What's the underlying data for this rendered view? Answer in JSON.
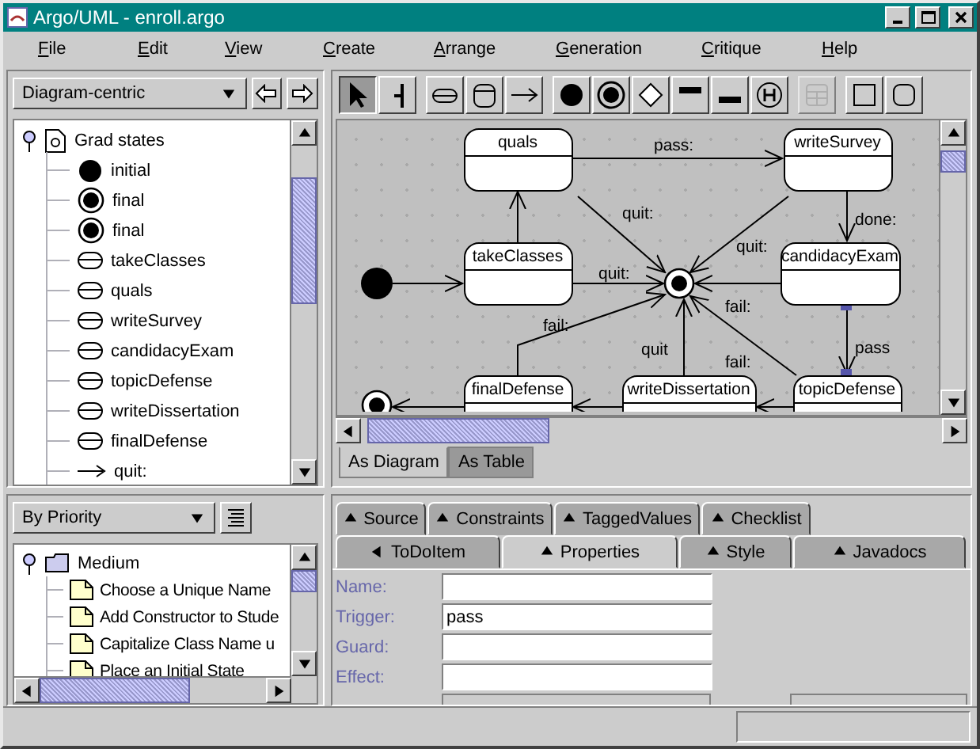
{
  "window": {
    "title": "Argo/UML - enroll.argo"
  },
  "menu": [
    "File",
    "Edit",
    "View",
    "Create",
    "Arrange",
    "Generation",
    "Critique",
    "Help"
  ],
  "navigator": {
    "perspective": "Diagram-centric",
    "tree": {
      "label": "Grad states",
      "expanded": true,
      "children": [
        {
          "label": "initial",
          "kind": "initial"
        },
        {
          "label": "final",
          "kind": "final"
        },
        {
          "label": "final",
          "kind": "final"
        },
        {
          "label": "takeClasses",
          "kind": "state"
        },
        {
          "label": "quals",
          "kind": "state"
        },
        {
          "label": "writeSurvey",
          "kind": "state"
        },
        {
          "label": "candidacyExam",
          "kind": "state"
        },
        {
          "label": "topicDefense",
          "kind": "state"
        },
        {
          "label": "writeDissertation",
          "kind": "state"
        },
        {
          "label": "finalDefense",
          "kind": "state"
        },
        {
          "label": "quit:",
          "kind": "transition"
        }
      ]
    }
  },
  "toolbar": [
    {
      "kind": "select",
      "selected": true,
      "disabled": false
    },
    {
      "kind": "broom",
      "selected": false,
      "disabled": false
    },
    {
      "kind": "state",
      "selected": false,
      "disabled": false
    },
    {
      "kind": "composite",
      "selected": false,
      "disabled": false
    },
    {
      "kind": "transition",
      "selected": false,
      "disabled": false
    },
    {
      "kind": "initial",
      "selected": false,
      "disabled": false
    },
    {
      "kind": "final",
      "selected": false,
      "disabled": false
    },
    {
      "kind": "branch",
      "selected": false,
      "disabled": false
    },
    {
      "kind": "fork",
      "selected": false,
      "disabled": false
    },
    {
      "kind": "join",
      "selected": false,
      "disabled": false
    },
    {
      "kind": "history",
      "selected": false,
      "disabled": false
    },
    {
      "kind": "concurrent",
      "selected": false,
      "disabled": true
    },
    {
      "kind": "rectangle",
      "selected": false,
      "disabled": false
    },
    {
      "kind": "rounded",
      "selected": false,
      "disabled": false
    }
  ],
  "diagram": {
    "states": [
      {
        "name": "quals"
      },
      {
        "name": "writeSurvey"
      },
      {
        "name": "takeClasses"
      },
      {
        "name": "candidacyExam"
      },
      {
        "name": "finalDefense"
      },
      {
        "name": "writeDissertation"
      },
      {
        "name": "topicDefense"
      }
    ],
    "pseudostates": [
      {
        "kind": "initial"
      },
      {
        "kind": "final"
      },
      {
        "kind": "final"
      }
    ],
    "transitions": [
      {
        "label": "pass:",
        "selected": false
      },
      {
        "label": "quit:",
        "selected": false
      },
      {
        "label": "done:",
        "selected": false
      },
      {
        "label": "quit:",
        "selected": false
      },
      {
        "label": "quit:",
        "selected": false
      },
      {
        "label": "fail:",
        "selected": false
      },
      {
        "label": "fail:",
        "selected": false
      },
      {
        "label": "quit",
        "selected": false
      },
      {
        "label": "fail:",
        "selected": false
      },
      {
        "label": "pass",
        "selected": true
      }
    ]
  },
  "view_tabs": [
    {
      "label": "As Diagram",
      "selected": true
    },
    {
      "label": "As Table",
      "selected": false
    }
  ],
  "todo": {
    "grouping": "By Priority",
    "tree": {
      "label": "Medium",
      "expanded": true,
      "children": [
        {
          "label": "Choose a Unique Name"
        },
        {
          "label": "Add Constructor to Stude"
        },
        {
          "label": "Capitalize Class Name u"
        },
        {
          "label": "Place an Initial State"
        }
      ]
    }
  },
  "detail_tabs": [
    [
      {
        "label": "Source",
        "selected": false,
        "kind": "up"
      },
      {
        "label": "Constraints",
        "selected": false,
        "kind": "up"
      },
      {
        "label": "TaggedValues",
        "selected": false,
        "kind": "up"
      },
      {
        "label": "Checklist",
        "selected": false,
        "kind": "up"
      }
    ],
    [
      {
        "label": "ToDoItem",
        "selected": false,
        "kind": "left"
      },
      {
        "label": "Properties",
        "selected": true,
        "kind": "up"
      },
      {
        "label": "Style",
        "selected": false,
        "kind": "up"
      },
      {
        "label": "Javadocs",
        "selected": false,
        "kind": "up"
      }
    ]
  ],
  "properties": [
    {
      "label": "Name:"
    },
    {
      "label": "Trigger:",
      "value": "pass"
    },
    {
      "label": "Guard:"
    },
    {
      "label": "Effect:"
    }
  ]
}
